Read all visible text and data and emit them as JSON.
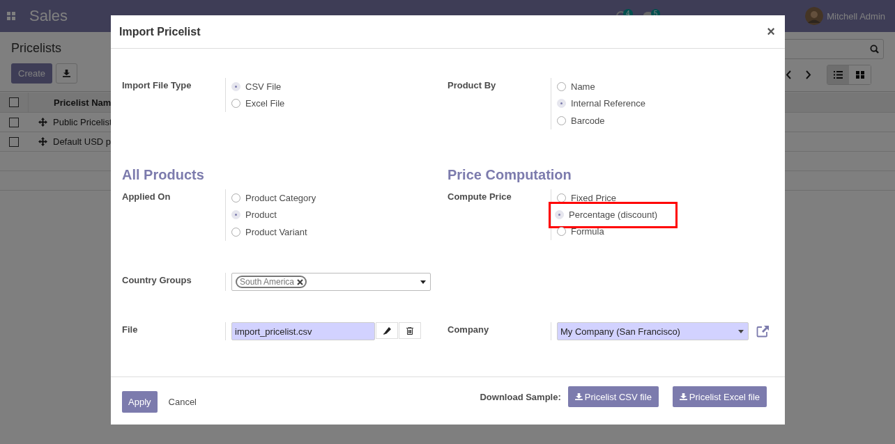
{
  "navbar": {
    "app": "Sales",
    "activity_count": "4",
    "message_count": "5",
    "user": "Mitchell Admin"
  },
  "control_panel": {
    "title": "Pricelists",
    "create": "Create"
  },
  "list": {
    "header": {
      "label": "Pricelist Nam",
      "checked": false
    },
    "rows": [
      {
        "name": "Public Pricelist",
        "checked": false
      },
      {
        "name": "Default USD p",
        "checked": false
      }
    ]
  },
  "dialog": {
    "title": "Import Pricelist",
    "close": "×",
    "rows": [
      {
        "cells": [
          {
            "kind": "radio",
            "label": "Import File Type",
            "options": [
              {
                "label": "CSV File",
                "selected": true
              },
              {
                "label": "Excel File",
                "selected": false
              }
            ]
          },
          {
            "kind": "radio",
            "label": "Product By",
            "options": [
              {
                "label": "Name",
                "selected": false
              },
              {
                "label": "Internal Reference",
                "selected": true
              },
              {
                "label": "Barcode",
                "selected": false
              }
            ]
          }
        ]
      },
      {
        "cells": [
          {
            "kind": "heading",
            "text": "All Products"
          },
          {
            "kind": "heading",
            "text": "Price Computation"
          }
        ]
      },
      {
        "cells": [
          {
            "kind": "radio",
            "label": "Applied On",
            "options": [
              {
                "label": "Product Category",
                "selected": false
              },
              {
                "label": "Product",
                "selected": true
              },
              {
                "label": "Product Variant",
                "selected": false
              }
            ]
          },
          {
            "kind": "radio",
            "label": "Compute Price",
            "options": [
              {
                "label": "Fixed Price",
                "selected": false,
                "highlighted": false
              },
              {
                "label": "Percentage (discount)",
                "selected": true,
                "highlighted": true
              },
              {
                "label": "Formula",
                "selected": false,
                "highlighted": false
              }
            ]
          }
        ]
      },
      {
        "cells": [
          {
            "kind": "tags",
            "label": "Country Groups",
            "tags": [
              "South America"
            ]
          }
        ]
      },
      {
        "cells": [
          {
            "kind": "file",
            "label": "File",
            "value": "import_pricelist.csv"
          },
          {
            "kind": "select",
            "label": "Company",
            "value": "My Company (San Francisco)"
          }
        ]
      }
    ],
    "apply": "Apply",
    "cancel": "Cancel",
    "download_label": "Download Sample:",
    "downloads": [
      "Pricelist CSV file",
      "Pricelist Excel file"
    ]
  }
}
